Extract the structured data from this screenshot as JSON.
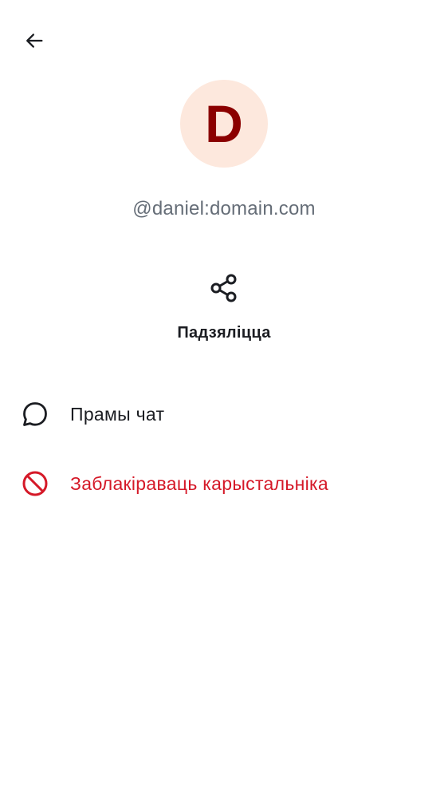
{
  "header": {
    "back_icon": "arrow-left-icon"
  },
  "profile": {
    "avatar_letter": "D",
    "avatar_bg": "#fde8dd",
    "avatar_fg": "#8b0000",
    "user_id": "@daniel:domain.com"
  },
  "actions": {
    "share_label": "Падзяліцца",
    "share_icon": "share-icon"
  },
  "menu": {
    "dm_label": "Прамы чат",
    "dm_icon": "chat-bubble-icon",
    "block_label": "Заблакіраваць карыстальніка",
    "block_icon": "block-icon",
    "block_color": "#d51928"
  }
}
